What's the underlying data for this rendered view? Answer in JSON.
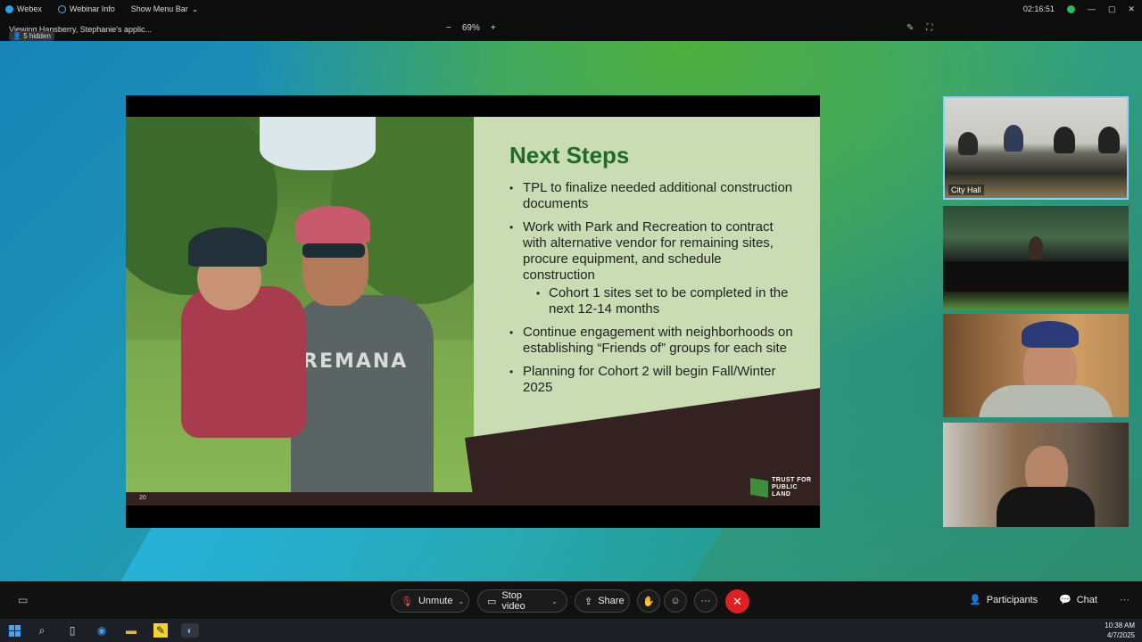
{
  "titlebar": {
    "app_name": "Webex",
    "webinar_info": "Webinar Info",
    "show_menu": "Show Menu Bar",
    "time": "02:16:51"
  },
  "strip": {
    "viewing": "Viewing Hansberry, Stephanie's applic...",
    "hidden": "5 hidden",
    "zoom_out": "−",
    "zoom_level": "69%",
    "zoom_in": "+"
  },
  "slide": {
    "title": "Next Steps",
    "bullets": [
      "TPL to finalize needed additional construction documents",
      "Work with Park and Recreation to contract with alternative vendor for remaining sites, procure equipment, and schedule construction",
      "Cohort 1 sites set to be completed in the next 12-14 months",
      "Continue engagement with neighborhoods on establishing “Friends of” groups for each site",
      "Planning for Cohort 2 will begin Fall/Winter 2025"
    ],
    "page_number": "20",
    "shirt_text": "REMANA",
    "logo_lines": [
      "TRUST FOR",
      "PUBLIC",
      "LAND"
    ]
  },
  "tiles": {
    "tile1_label": "City Hall"
  },
  "controls": {
    "unmute": "Unmute",
    "stop_video": "Stop video",
    "share": "Share",
    "more": "···",
    "participants": "Participants",
    "chat": "Chat"
  },
  "taskbar": {
    "time": "10:38 AM",
    "date": "4/7/2025"
  }
}
